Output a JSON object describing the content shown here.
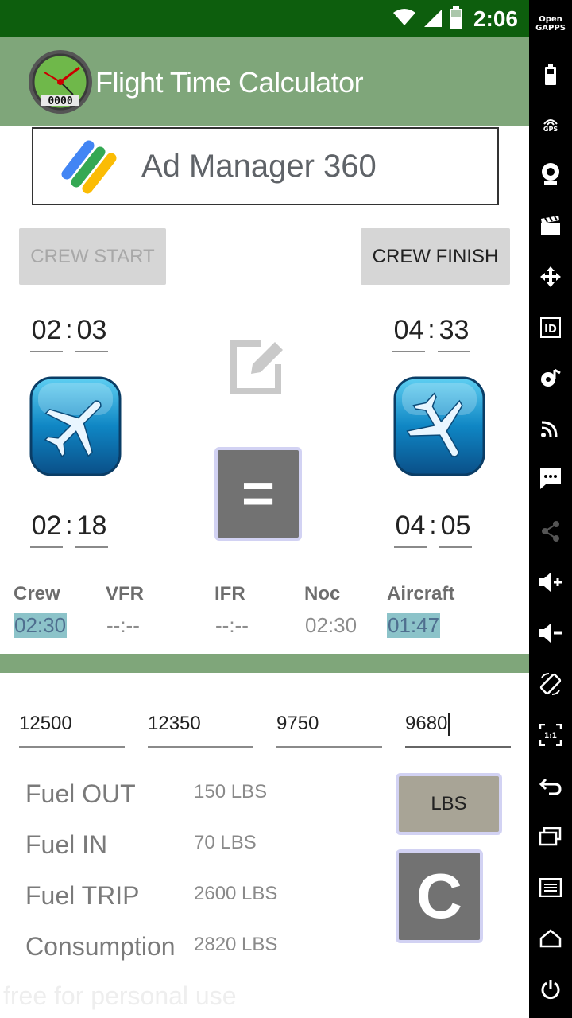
{
  "status_bar": {
    "time": "2:06",
    "icons": [
      "wifi-icon",
      "cell-signal-icon",
      "battery-icon"
    ]
  },
  "app_bar": {
    "title": "Flight Time Calculator",
    "logo": "gauge-logo-icon",
    "logo_digits": "0000"
  },
  "ad_banner": {
    "text": "Ad Manager 360"
  },
  "crew": {
    "start_label": "CREW START",
    "finish_label": "CREW FINISH",
    "start_time": {
      "hours": "02",
      "minutes": "03"
    },
    "finish_time": {
      "hours": "04",
      "minutes": "33"
    }
  },
  "flight": {
    "takeoff_time": {
      "hours": "02",
      "minutes": "18"
    },
    "landing_time": {
      "hours": "04",
      "minutes": "05"
    },
    "takeoff_icon": "airplane-takeoff-icon",
    "landing_icon": "airplane-landing-icon"
  },
  "actions": {
    "edit_icon": "edit-icon",
    "equals_label": "=",
    "clear_label": "C",
    "units_label": "LBS"
  },
  "summary": {
    "columns": [
      {
        "label": "Crew",
        "value": "02:30",
        "highlighted": true
      },
      {
        "label": "VFR",
        "value": "--:--",
        "highlighted": false
      },
      {
        "label": "IFR",
        "value": "--:--",
        "highlighted": false
      },
      {
        "label": "Noc",
        "value": "02:30",
        "highlighted": false
      },
      {
        "label": "Aircraft",
        "value": "01:47",
        "highlighted": true
      }
    ]
  },
  "fuel_inputs": [
    "12500",
    "12350",
    "9750",
    "9680"
  ],
  "fuel_results": [
    {
      "label": "Fuel OUT",
      "value": "150 LBS"
    },
    {
      "label": "Fuel IN",
      "value": "70 LBS"
    },
    {
      "label": "Fuel TRIP",
      "value": "2600 LBS"
    },
    {
      "label": "Consumption",
      "value": "2820 LBS"
    }
  ],
  "watermark": "free for personal use",
  "side_nav": {
    "brand_line1": "Open",
    "brand_line2": "GAPPS",
    "gps_label": "GPS",
    "id_label": "ID",
    "items": [
      "battery-icon",
      "gps-icon",
      "camera-icon",
      "clapperboard-icon",
      "move-icon",
      "id-icon",
      "music-note-icon",
      "cast-icon",
      "message-icon",
      "share-icon",
      "volume-up-icon",
      "volume-down-icon",
      "rotate-icon",
      "scale-icon",
      "back-icon",
      "recents-icon",
      "menu-icon",
      "home-icon",
      "power-icon"
    ]
  },
  "colors": {
    "status_bar": "#0d5e0d",
    "app_bar": "#7fa67a",
    "highlight": "#8cc3c9",
    "button_gray": "#727272",
    "lbs_button": "#a8a496"
  }
}
